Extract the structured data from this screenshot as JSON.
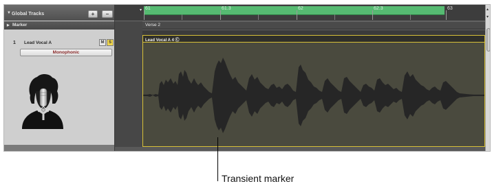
{
  "global_tracks": {
    "label": "Global Tracks",
    "add_label": "+",
    "remove_label": "–"
  },
  "marker_track": {
    "label": "Marker",
    "marker_name": "Verse 2"
  },
  "ruler": {
    "bars": [
      "61",
      "61.3",
      "62",
      "62.3",
      "63"
    ]
  },
  "track": {
    "number": "1",
    "name": "Lead Vocal A",
    "mute_label": "M",
    "solo_label": "S",
    "mode": "Monophonic",
    "icon": "singer-with-microphone-icon"
  },
  "region": {
    "name": "Lead Vocal A 4 Ⓒ"
  },
  "callout": {
    "label": "Transient marker"
  },
  "colors": {
    "cycle": "#56bb72",
    "region_border": "#d9c238",
    "solo": "#f0d64d"
  }
}
